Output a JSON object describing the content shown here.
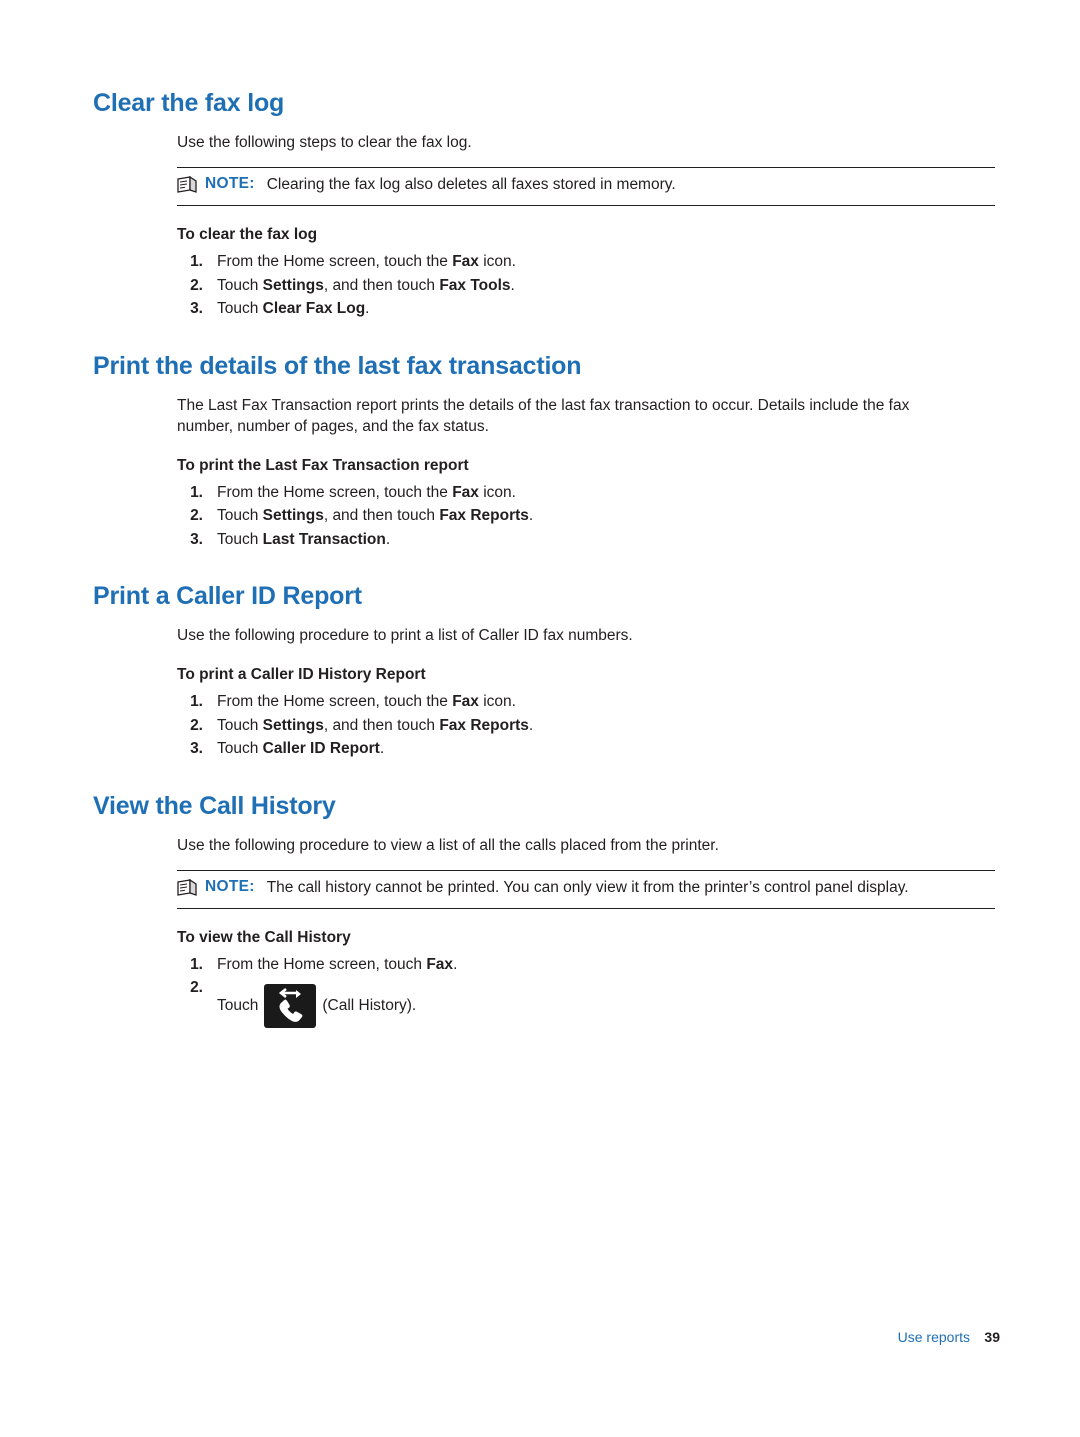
{
  "sections": [
    {
      "title": "Clear the fax log",
      "intro": "Use the following steps to clear the fax log.",
      "note": {
        "label": "NOTE:",
        "text": "Clearing the fax log also deletes all faxes stored in memory."
      },
      "procedure_title": "To clear the fax log",
      "steps": [
        {
          "num": "1.",
          "parts": [
            {
              "t": "From the Home screen, touch the ",
              "b": false
            },
            {
              "t": "Fax",
              "b": true
            },
            {
              "t": " icon.",
              "b": false
            }
          ]
        },
        {
          "num": "2.",
          "parts": [
            {
              "t": "Touch ",
              "b": false
            },
            {
              "t": "Settings",
              "b": true
            },
            {
              "t": ", and then touch ",
              "b": false
            },
            {
              "t": "Fax Tools",
              "b": true
            },
            {
              "t": ".",
              "b": false
            }
          ]
        },
        {
          "num": "3.",
          "parts": [
            {
              "t": "Touch ",
              "b": false
            },
            {
              "t": "Clear Fax Log",
              "b": true
            },
            {
              "t": ".",
              "b": false
            }
          ]
        }
      ]
    },
    {
      "title": "Print the details of the last fax transaction",
      "intro": "The Last Fax Transaction report prints the details of the last fax transaction to occur. Details include the fax number, number of pages, and the fax status.",
      "procedure_title": "To print the Last Fax Transaction report",
      "steps": [
        {
          "num": "1.",
          "parts": [
            {
              "t": "From the Home screen, touch the ",
              "b": false
            },
            {
              "t": "Fax",
              "b": true
            },
            {
              "t": " icon.",
              "b": false
            }
          ]
        },
        {
          "num": "2.",
          "parts": [
            {
              "t": "Touch ",
              "b": false
            },
            {
              "t": "Settings",
              "b": true
            },
            {
              "t": ", and then touch ",
              "b": false
            },
            {
              "t": "Fax Reports",
              "b": true
            },
            {
              "t": ".",
              "b": false
            }
          ]
        },
        {
          "num": "3.",
          "parts": [
            {
              "t": "Touch ",
              "b": false
            },
            {
              "t": "Last Transaction",
              "b": true
            },
            {
              "t": ".",
              "b": false
            }
          ]
        }
      ]
    },
    {
      "title": "Print a Caller ID Report",
      "intro": "Use the following procedure to print a list of Caller ID fax numbers.",
      "procedure_title": "To print a Caller ID History Report",
      "steps": [
        {
          "num": "1.",
          "parts": [
            {
              "t": "From the Home screen, touch the ",
              "b": false
            },
            {
              "t": "Fax",
              "b": true
            },
            {
              "t": " icon.",
              "b": false
            }
          ]
        },
        {
          "num": "2.",
          "parts": [
            {
              "t": "Touch ",
              "b": false
            },
            {
              "t": "Settings",
              "b": true
            },
            {
              "t": ", and then touch ",
              "b": false
            },
            {
              "t": "Fax Reports",
              "b": true
            },
            {
              "t": ".",
              "b": false
            }
          ]
        },
        {
          "num": "3.",
          "parts": [
            {
              "t": "Touch ",
              "b": false
            },
            {
              "t": "Caller ID Report",
              "b": true
            },
            {
              "t": ".",
              "b": false
            }
          ]
        }
      ]
    },
    {
      "title": "View the Call History",
      "intro": "Use the following procedure to view a list of all the calls placed from the printer.",
      "note": {
        "label": "NOTE:",
        "text": "The call history cannot be printed. You can only view it from the printer’s control panel display."
      },
      "procedure_title": "To view the Call History",
      "steps": [
        {
          "num": "1.",
          "parts": [
            {
              "t": "From the Home screen, touch ",
              "b": false
            },
            {
              "t": "Fax",
              "b": true
            },
            {
              "t": ".",
              "b": false
            }
          ]
        },
        {
          "num": "2.",
          "parts": []
        }
      ],
      "icon_step": {
        "prefix": "Touch",
        "suffix": "(Call History).",
        "icon_name": "call-history-icon"
      }
    }
  ],
  "footer": {
    "chapter": "Use reports",
    "page_number": "39"
  },
  "colors": {
    "heading_blue": "#1f6fb5",
    "text_black": "#231f20"
  }
}
